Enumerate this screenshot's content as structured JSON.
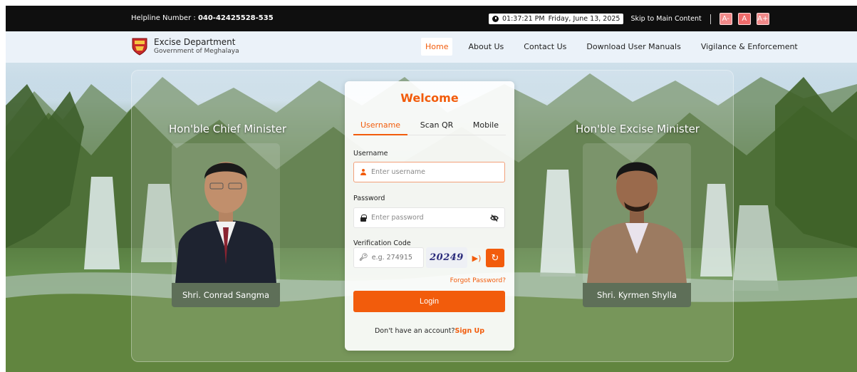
{
  "topbar": {
    "helpline_label": "Helpline Number :",
    "helpline_number": "040-42425528-535",
    "time": "01:37:21 PM",
    "date": "Friday, June 13, 2025",
    "skip_link": "Skip to Main Content",
    "font_small": "A-",
    "font_normal": "A",
    "font_large": "A+"
  },
  "header": {
    "org_name": "Excise Department",
    "org_sub": "Government of Meghalaya",
    "nav": [
      "Home",
      "About Us",
      "Contact Us",
      "Download User Manuals",
      "Vigilance & Enforcement"
    ],
    "active_nav": "Home"
  },
  "left_minister": {
    "title": "Hon'ble Chief Minister",
    "name": "Shri. Conrad Sangma"
  },
  "right_minister": {
    "title": "Hon'ble Excise Minister",
    "name": "Shri. Kyrmen Shylla"
  },
  "login": {
    "welcome": "Welcome",
    "tabs": [
      "Username",
      "Scan QR",
      "Mobile"
    ],
    "active_tab": "Username",
    "username_label": "Username",
    "username_placeholder": "Enter username",
    "password_label": "Password",
    "password_placeholder": "Enter password",
    "verification_label": "Verification Code",
    "verification_placeholder": "e.g. 274915",
    "captcha": "20249",
    "forgot": "Forgot Password?",
    "login_button": "Login",
    "signup_prompt": "Don't have an account?",
    "signup_link": "Sign Up"
  },
  "colors": {
    "accent": "#f25c0c",
    "topbar_bg": "#0f0f0f",
    "name_plate": "#5e6f58"
  }
}
